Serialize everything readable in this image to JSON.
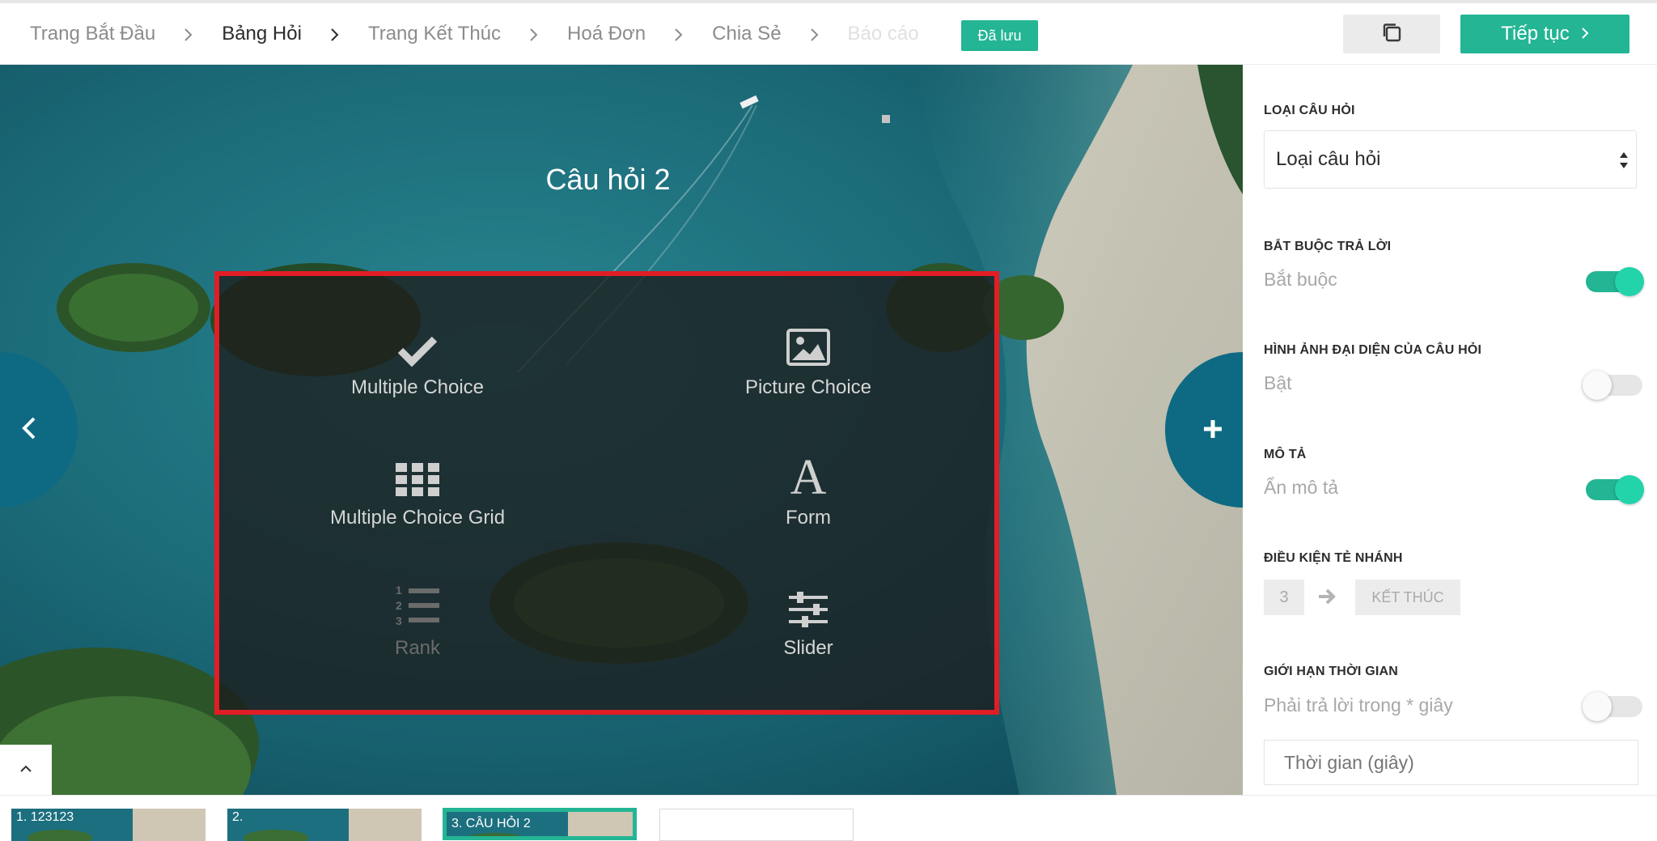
{
  "breadcrumb": {
    "items": [
      {
        "label": "Trang Bắt Đầu"
      },
      {
        "label": "Bảng Hỏi"
      },
      {
        "label": "Trang Kết Thúc"
      },
      {
        "label": "Hoá Đơn"
      },
      {
        "label": "Chia Sẻ"
      },
      {
        "label": "Báo cáo"
      }
    ]
  },
  "header": {
    "saved_badge": "Đã lưu",
    "copy_icon": "copy-icon",
    "continue_label": "Tiếp tục"
  },
  "question": {
    "title": "Câu hỏi 2"
  },
  "question_types": {
    "multiple_choice": "Multiple Choice",
    "picture_choice": "Picture Choice",
    "multiple_choice_grid": "Multiple Choice Grid",
    "form": "Form",
    "rank": "Rank",
    "slider": "Slider"
  },
  "sidebar": {
    "question_type": {
      "label": "LOẠI CÂU HỎI",
      "value": "Loại câu hỏi"
    },
    "required": {
      "label": "BẮT BUỘC TRẢ LỜI",
      "text": "Bắt buộc",
      "on": true
    },
    "image": {
      "label": "HÌNH ẢNH ĐẠI DIỆN CỦA CÂU HỎI",
      "text": "Bật",
      "on": false
    },
    "description": {
      "label": "MÔ TẢ",
      "text": "Ẩn mô tả",
      "on": true
    },
    "branching": {
      "label": "ĐIỀU KIỆN TẺ NHÁNH",
      "from": "3",
      "to": "KẾT THÚC"
    },
    "time_limit": {
      "label": "GIỚI HẠN THỜI GIAN",
      "text": "Phải trả lời trong * giây",
      "on": false,
      "placeholder": "Thời gian (giây)"
    }
  },
  "filmstrip": {
    "items": [
      {
        "label": "1. 123123"
      },
      {
        "label": "2."
      },
      {
        "label": "3. CÂU HỎI 2"
      }
    ]
  },
  "colors": {
    "accent": "#23b594",
    "highlight_border": "#e11d25",
    "nav_circle": "#0e6a83"
  }
}
